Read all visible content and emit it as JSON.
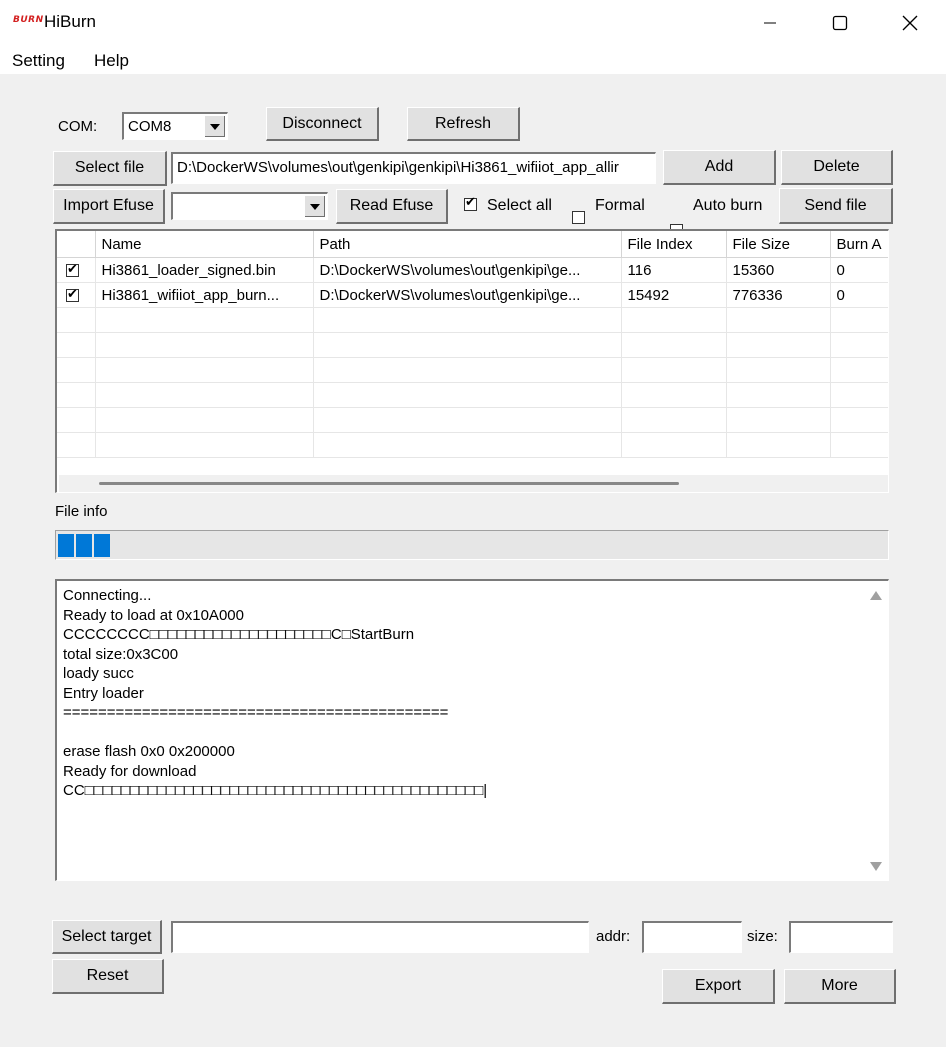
{
  "window": {
    "logo_text": "BURN",
    "title": "HiBurn",
    "minimize_glyph": "—",
    "maximize_glyph": "☐",
    "close_glyph": "✕"
  },
  "menu": {
    "items": [
      "Setting",
      "Help"
    ]
  },
  "com": {
    "label": "COM:",
    "value": "COM8",
    "disconnect_label": "Disconnect",
    "refresh_label": "Refresh"
  },
  "file": {
    "select_label": "Select file",
    "path": "D:\\DockerWS\\volumes\\out\\genkipi\\genkipi\\Hi3861_wifiiot_app_allir",
    "add_label": "Add",
    "delete_label": "Delete"
  },
  "efuse": {
    "import_label": "Import Efuse",
    "combo_value": "",
    "read_label": "Read Efuse",
    "select_all_label": "Select all",
    "select_all_checked": true,
    "formal_label": "Formal",
    "formal_checked": false,
    "auto_burn_label": "Auto burn",
    "auto_burn_checked": false,
    "send_file_label": "Send file"
  },
  "table": {
    "columns": [
      "Name",
      "Path",
      "File Index",
      "File Size",
      "Burn A"
    ],
    "rows": [
      {
        "checked": true,
        "cells": [
          "Hi3861_loader_signed.bin",
          "D:\\DockerWS\\volumes\\out\\genkipi\\ge...",
          "116",
          "15360",
          "0"
        ]
      },
      {
        "checked": true,
        "cells": [
          "Hi3861_wifiiot_app_burn...",
          "D:\\DockerWS\\volumes\\out\\genkipi\\ge...",
          "15492",
          "776336",
          "0"
        ]
      }
    ]
  },
  "file_info": {
    "label": "File info",
    "progress_blocks": 3
  },
  "log": {
    "lines": [
      "Connecting...",
      "Ready to load at 0x10A000",
      "CCCCCCCC□□□□□□□□□□□□□□□□□□□□C□StartBurn",
      "total size:0x3C00",
      "loady succ",
      "Entry loader",
      "============================================",
      "",
      "erase flash 0x0 0x200000",
      "Ready for download",
      "CC□□□□□□□□□□□□□□□□□□□□□□□□□□□□□□□□□□□□□□□□□□□□|"
    ]
  },
  "target": {
    "select_label": "Select target",
    "value": "",
    "addr_label": "addr:",
    "addr_value": "",
    "size_label": "size:",
    "size_value": ""
  },
  "bottom": {
    "reset_label": "Reset",
    "export_label": "Export",
    "more_label": "More"
  },
  "colors": {
    "progress": "#0078d7",
    "logo": "#d32020"
  }
}
